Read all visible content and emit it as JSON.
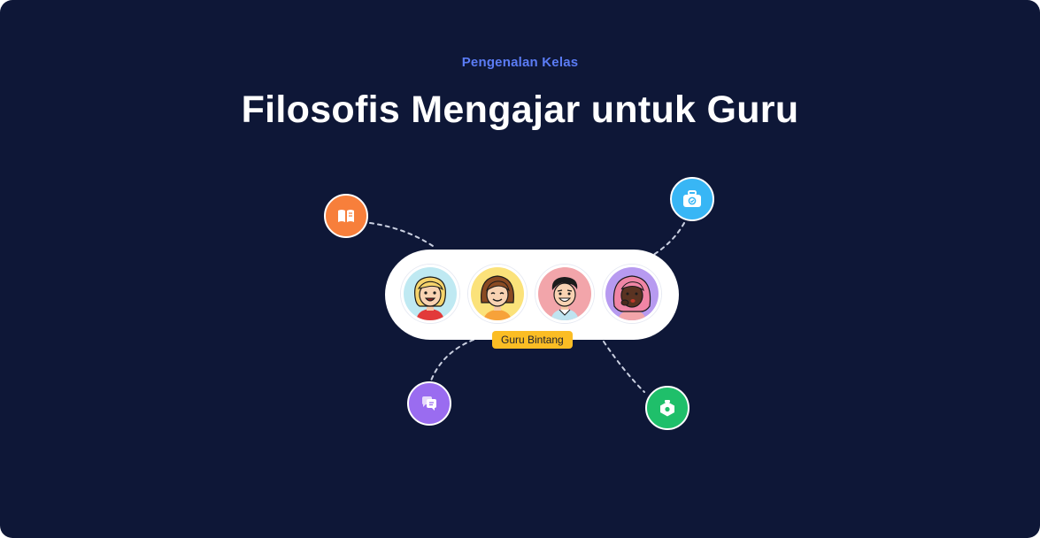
{
  "header": {
    "eyebrow": "Pengenalan Kelas",
    "title": "Filosofis Mengajar untuk Guru"
  },
  "group": {
    "badge_label": "Guru Bintang",
    "avatars": [
      {
        "name": "blonde-girl-avatar",
        "bg": "#bfe9f2"
      },
      {
        "name": "brown-hair-girl-avatar",
        "bg": "#fbe27a"
      },
      {
        "name": "black-hair-boy-avatar",
        "bg": "#f2a5aa"
      },
      {
        "name": "pink-hair-girl-avatar",
        "bg": "#b79af0"
      }
    ]
  },
  "nodes": [
    {
      "icon": "book-icon",
      "color": "#f77f3b"
    },
    {
      "icon": "briefcase-icon",
      "color": "#38b6f5"
    },
    {
      "icon": "chat-icon",
      "color": "#9a6cf0"
    },
    {
      "icon": "box-icon",
      "color": "#1fbf6a"
    }
  ],
  "colors": {
    "background": "#0e1737",
    "accent": "#5b7cf5",
    "badge": "#fbbd24"
  }
}
